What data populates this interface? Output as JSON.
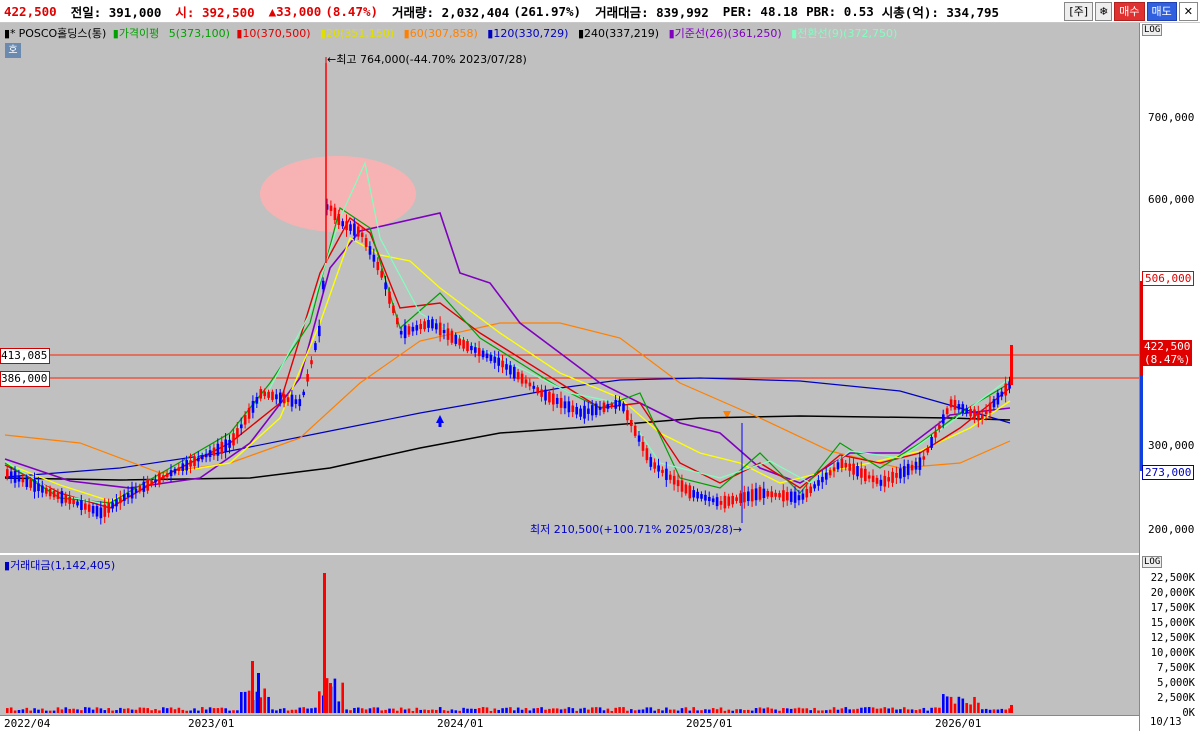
{
  "topbar": {
    "price": "422,500",
    "prev_close_label": "전일: 391,000",
    "open_label": "시: 392,500",
    "change": "▲33,000",
    "change_pct": "(8.47%)",
    "volume_label": "거래량: 2,032,404",
    "volume_ratio": "(261.97%)",
    "amount_label": "거래대금: 839,992",
    "per_label": "PER: 48.18",
    "pbr_label": "PBR: 0.53",
    "mcap_label": "시총(억): 334,795",
    "btn_week": "[주]",
    "btn_buy": "매수",
    "btn_sell": "매도"
  },
  "legend": {
    "name": "POSCO홀딩스(통)",
    "ma_title": "가격이평",
    "ma5": "5(373,100)",
    "ma10": "10(370,500)",
    "ma20": "20(351,150)",
    "ma60": "60(307,858)",
    "ma120": "120(330,729)",
    "ma240": "240(337,219)",
    "kijun": "기준선(26)(361,250)",
    "tenkan": "전환선(9)(372,750)",
    "ho_tag": "호"
  },
  "annotations": {
    "high": "←최고 764,000(-44.70% 2023/07/28)",
    "low": "최저 210,500(+100.71% 2025/03/28)→"
  },
  "hlines": {
    "line1_label": "413,085",
    "line2_label": "386,000"
  },
  "right_axis": {
    "price_ticks": [
      "700,000",
      "600,000",
      "506,000",
      "422,500",
      "(8.47%)",
      "273,000",
      "300,000",
      "200,000"
    ],
    "top_tag": "LOG",
    "vol_tag": "LOG",
    "vol_ticks": [
      "22,500K",
      "20,000K",
      "17,500K",
      "15,000K",
      "12,500K",
      "10,000K",
      "7,500K",
      "5,000K",
      "2,500K",
      "0K"
    ]
  },
  "volume_panel": {
    "label": "거래대금(1,142,405)"
  },
  "x_axis": {
    "labels": [
      "2022/04",
      "2023/01",
      "2024/01",
      "2025/01",
      "2026/01",
      "10/13"
    ]
  },
  "colors": {
    "up": "#ff0000",
    "down": "#0000ff",
    "ma5": "#00a000",
    "ma10": "#e00000",
    "ma20": "#ffff00",
    "ma60": "#ff8000",
    "ma120": "#0000c0",
    "ma240": "#000000",
    "kijun": "#8000c0",
    "tenkan": "#80ffc0",
    "background": "#c0c0c0"
  }
}
